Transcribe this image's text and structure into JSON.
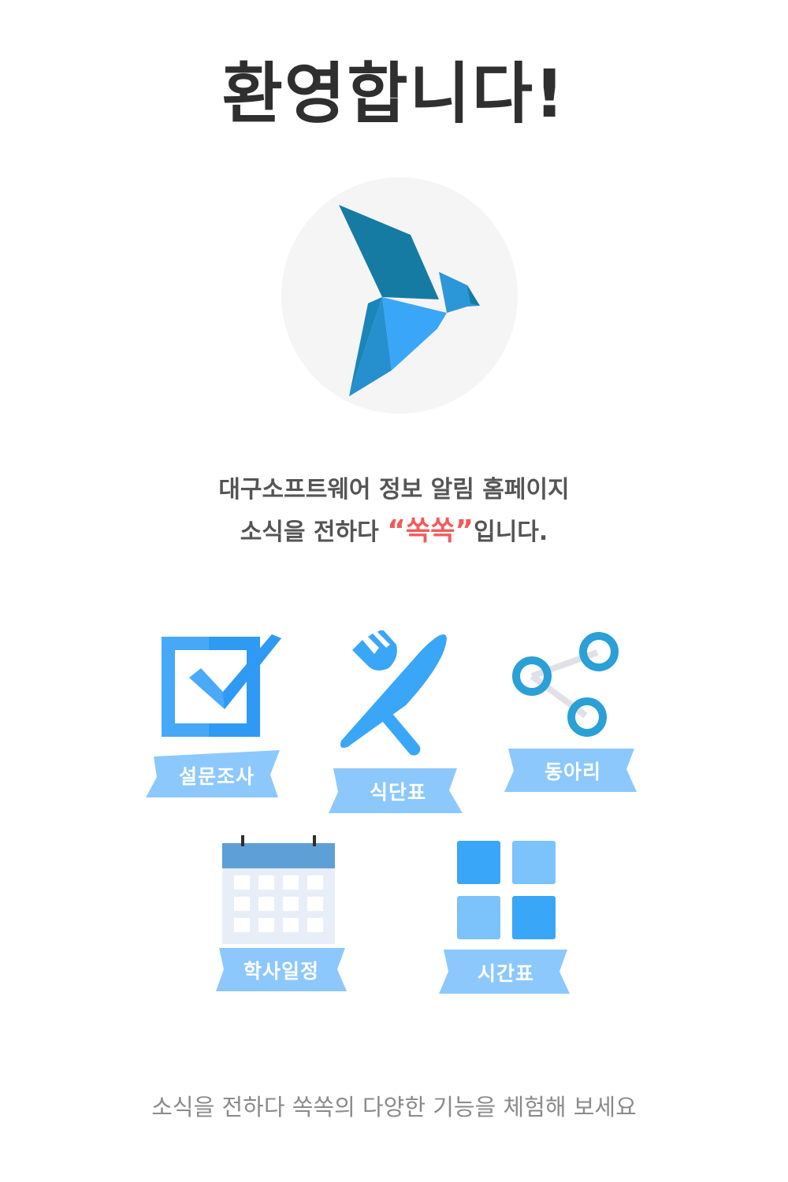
{
  "page": {
    "title": "환영합니다!",
    "logo_icon": "origami-bird-icon",
    "intro_line1": "대구소프트웨어 정보 알림 홈페이지",
    "intro_line2_prefix": "소식을 전하다 ",
    "intro_open_quote": "“",
    "intro_highlight": "쏙쏙",
    "intro_close_quote": "”",
    "intro_line2_suffix": "입니다.",
    "footer": "소식을 전하다 쏙쏙의 다양한 기능을 체험해 보세요"
  },
  "features": {
    "survey": {
      "label": "설문조사",
      "icon": "checkbox-icon"
    },
    "menu": {
      "label": "식단표",
      "icon": "fork-knife-icon"
    },
    "club": {
      "label": "동아리",
      "icon": "share-icon"
    },
    "schedule": {
      "label": "학사일정",
      "icon": "calendar-icon"
    },
    "timetable": {
      "label": "시간표",
      "icon": "grid-icon"
    }
  },
  "colors": {
    "ribbon": "#8cc8fb",
    "primary_blue": "#3aa6f7",
    "dark_blue": "#167ba3",
    "highlight": "#f25a5a"
  }
}
